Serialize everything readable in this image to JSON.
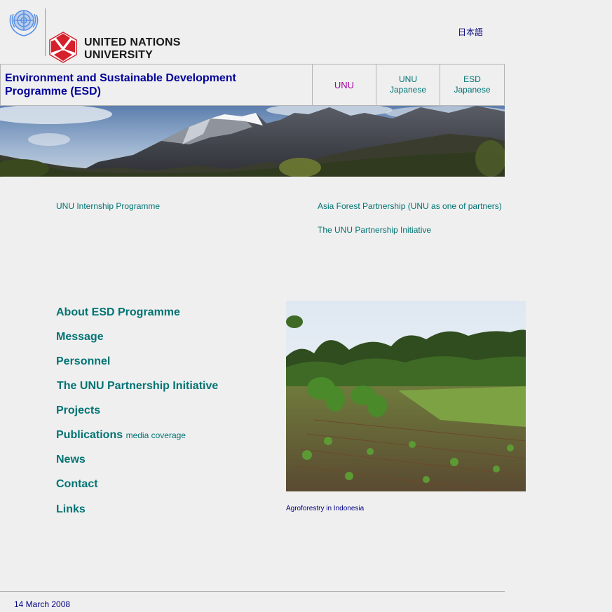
{
  "header": {
    "org_name_line1": "UNITED NATIONS",
    "org_name_line2": "UNIVERSITY",
    "language_link": "日本語"
  },
  "title_bar": {
    "title_line1": "Environment and Sustainable Development",
    "title_line2": "Programme (ESD)",
    "nav": [
      {
        "line1": "UNU",
        "line2": ""
      },
      {
        "line1": "UNU",
        "line2": "Japanese"
      },
      {
        "line1": "ESD",
        "line2": "Japanese"
      }
    ]
  },
  "quick_links": {
    "internship": "UNU Internship Programme",
    "asia_forest": "Asia Forest Partnership (UNU as one of partners)",
    "partnership": "The UNU Partnership Initiative"
  },
  "menu": [
    {
      "label": "About ESD Programme",
      "sub": ""
    },
    {
      "label": "Message",
      "sub": ""
    },
    {
      "label": "Personnel",
      "sub": ""
    },
    {
      "label": "The UNU Partnership Initiative",
      "sub": ""
    },
    {
      "label": "Projects",
      "sub": ""
    },
    {
      "label": "Publications",
      "sub": "media coverage"
    },
    {
      "label": "News",
      "sub": ""
    },
    {
      "label": "Contact",
      "sub": ""
    },
    {
      "label": "Links",
      "sub": ""
    }
  ],
  "photo": {
    "caption": "Agroforestry in Indonesia"
  },
  "footer": {
    "date": "14 March 2008"
  },
  "colors": {
    "background": "#efefef",
    "title": "#000099",
    "link_teal": "#007373",
    "link_visited": "#a000a0",
    "navy": "#000080",
    "un_blue": "#5b92e5",
    "unu_red": "#d6202b"
  }
}
